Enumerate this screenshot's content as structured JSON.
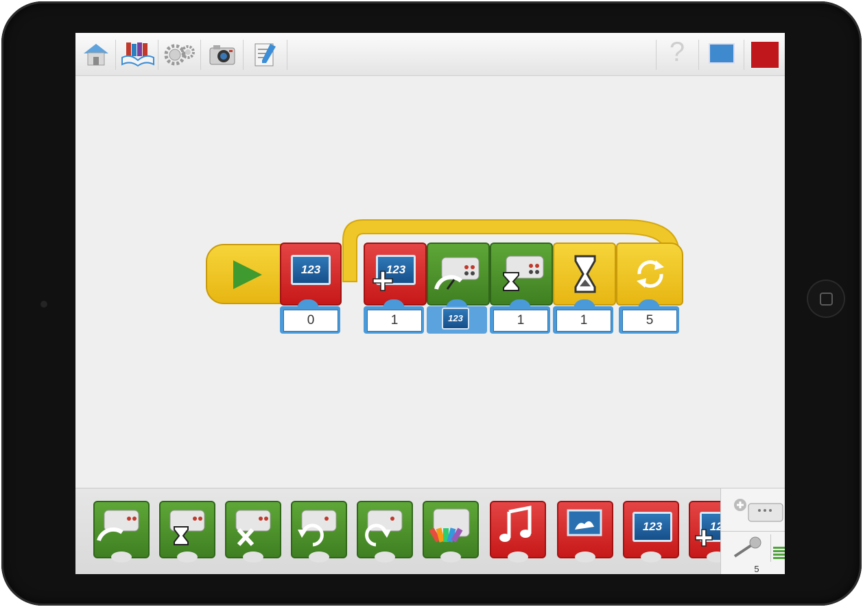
{
  "toolbar": {
    "left_icons": [
      "home-icon",
      "books-icon",
      "gears-icon",
      "camera-icon",
      "documentation-icon"
    ],
    "help_label": "?",
    "right_icons": [
      "display-icon",
      "stop-icon"
    ]
  },
  "program": {
    "start_icon": "play-icon",
    "blocks": [
      {
        "name": "set-display-number",
        "color": "red",
        "icon": "123",
        "value": "0"
      },
      {
        "name": "add-display-number",
        "color": "red",
        "icon": "123",
        "value": "1"
      },
      {
        "name": "motor-power",
        "color": "green",
        "icon": "motor-speed",
        "value_icon": "123"
      },
      {
        "name": "motor-on-for",
        "color": "green",
        "icon": "motor-hourglass",
        "value": "1"
      },
      {
        "name": "wait-for",
        "color": "yellow",
        "icon": "hourglass",
        "value": "1"
      },
      {
        "name": "repeat",
        "color": "yellow",
        "icon": "loop",
        "value": "5"
      }
    ]
  },
  "palette": {
    "blocks": [
      {
        "name": "motor-power",
        "color": "green"
      },
      {
        "name": "motor-on-for",
        "color": "green"
      },
      {
        "name": "motor-off",
        "color": "green"
      },
      {
        "name": "motor-ccw",
        "color": "green"
      },
      {
        "name": "motor-cw",
        "color": "green"
      },
      {
        "name": "light-color",
        "color": "green"
      },
      {
        "name": "play-sound",
        "color": "red"
      },
      {
        "name": "display-image",
        "color": "red"
      },
      {
        "name": "display-number",
        "color": "red"
      },
      {
        "name": "add-display-number",
        "color": "red"
      }
    ],
    "display_text": "123",
    "counter": "5"
  }
}
